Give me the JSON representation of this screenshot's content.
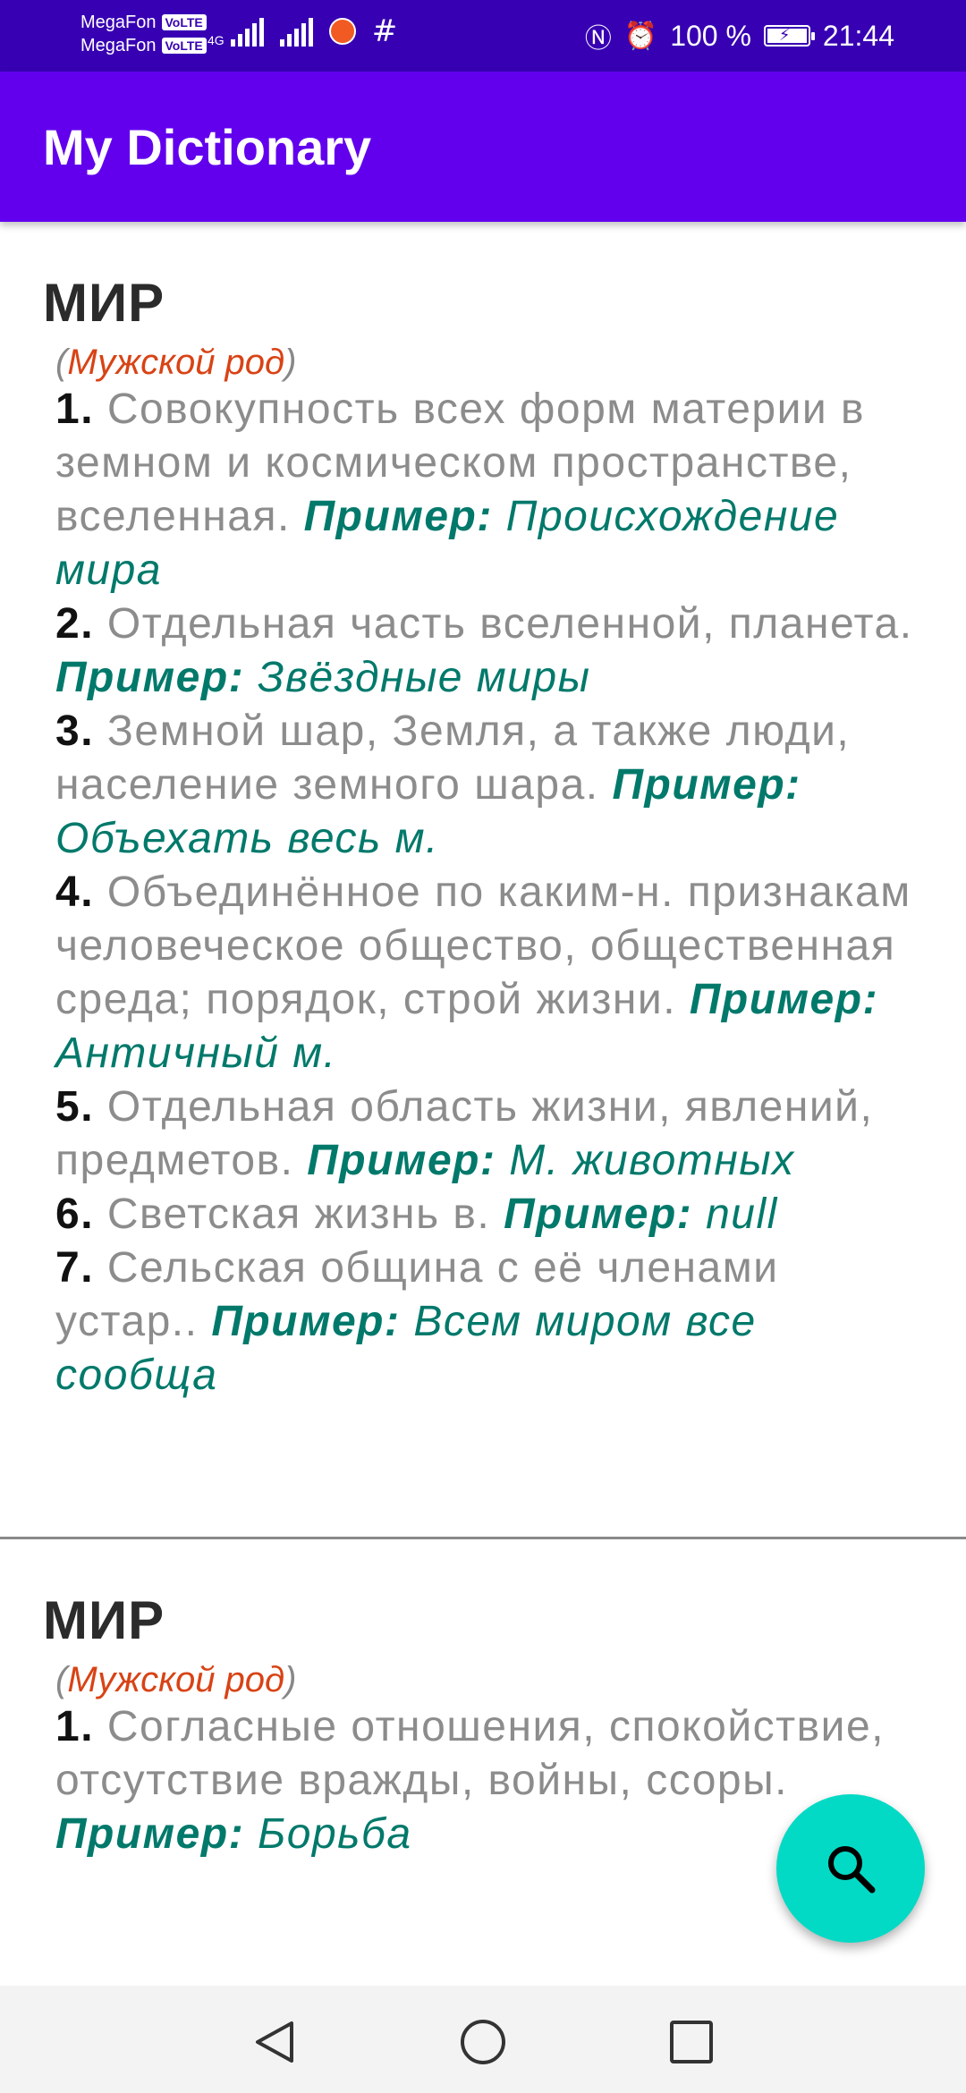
{
  "status_bar": {
    "operator_1": "MegaFon",
    "operator_2": "MegaFon",
    "volte": "VoLTE",
    "network": "4G",
    "battery_percent": "100 %",
    "battery_level": 1.0,
    "time": "21:44",
    "icons": [
      "signal-icon",
      "app-notification-icon",
      "hash-icon",
      "nfc-icon",
      "alarm-icon",
      "battery-charging-icon"
    ]
  },
  "app_bar": {
    "title": "My Dictionary"
  },
  "entries": [
    {
      "word": "МИР",
      "gender": "Мужской род",
      "definitions": [
        {
          "num": "1.",
          "text": "Совокупность всех форм материи в земном и космическом пространстве, вселенная.",
          "example_label": "Пример:",
          "example": "Происхождение мира"
        },
        {
          "num": "2.",
          "text": "Отдельная часть вселенной, планета.",
          "example_label": "Пример:",
          "example": "Звёздные миры"
        },
        {
          "num": "3.",
          "text": "Земной шар, Земля, а также люди, население земного шара.",
          "example_label": "Пример:",
          "example": "Объехать весь м."
        },
        {
          "num": "4.",
          "text": "Объединённое по каким-н. признакам человеческое общество, общественная среда; порядок, строй жизни.",
          "example_label": "Пример:",
          "example": "Античный м."
        },
        {
          "num": "5.",
          "text": "Отдельная область жизни, явлений, предметов.",
          "example_label": "Пример:",
          "example": "М. животных"
        },
        {
          "num": "6.",
          "text": "Светская жизнь в.",
          "example_label": "Пример:",
          "example": "null"
        },
        {
          "num": "7.",
          "text": "Сельская община с её членами устар..",
          "example_label": "Пример:",
          "example": "Всем миром все сообща"
        }
      ]
    },
    {
      "word": "МИР",
      "gender": "Мужской род",
      "definitions": [
        {
          "num": "1.",
          "text": "Согласные отношения, спокойствие, отсутствие вражды, войны, ссоры.",
          "example_label": "Пример:",
          "example": "Борьба"
        }
      ]
    }
  ],
  "fab": {
    "icon": "search-icon"
  },
  "nav_bar": {
    "buttons": [
      "back-icon",
      "home-icon",
      "recents-icon"
    ]
  },
  "colors": {
    "status_bar": "#3700b3",
    "app_bar": "#6200ee",
    "fab": "#03dac5",
    "example": "#00796b",
    "gender": "#d84315"
  }
}
